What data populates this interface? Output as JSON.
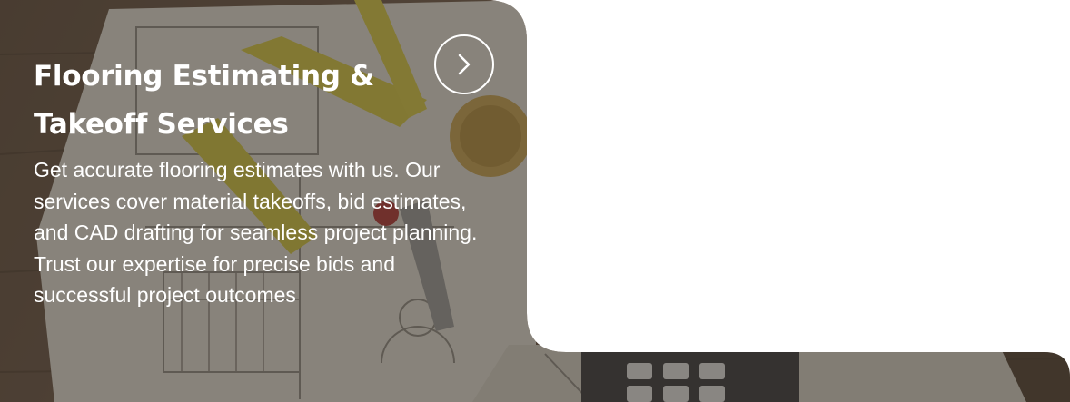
{
  "card": {
    "title": "Flooring Estimating & Takeoff Services",
    "description": "Get accurate flooring estimates with us. Our services cover material takeoffs, bid estimates, and CAD drafting for seamless project planning. Trust our expertise for precise bids and successful project outcomes",
    "action_icon": "chevron-right-icon"
  },
  "colors": {
    "text": "#ffffff",
    "overlay": "#3b352e",
    "page_background": "#ffffff"
  }
}
